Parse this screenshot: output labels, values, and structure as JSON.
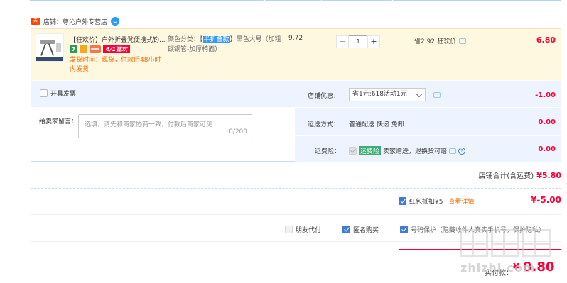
{
  "shop": {
    "icon": "tmall-shop-icon",
    "label": "店铺：尊沁户外专营店"
  },
  "item": {
    "title": "【狂欢价】户外折叠凳便携式钓...",
    "badge_7": "7",
    "badge_618": "6/1狂欢",
    "shipping": "发货时间：现货，付款后48小时内发货",
    "sku_prefix": "颜色分类：【",
    "sku_highlight": "半折叠款",
    "sku_rest": "】黑色大号（加粗碳钢管-加厚椅面）",
    "price": "9.72",
    "quantity": "1",
    "minus": "−",
    "plus": "+",
    "saving": "省2.92:狂欢价",
    "total": "6.80"
  },
  "invoice": {
    "label": "开具发票"
  },
  "message": {
    "label": "给卖家留言：",
    "placeholder": "选填，请先和商家协商一致，付款后商家可见",
    "count": "0/200"
  },
  "discount": {
    "label": "店铺优惠：",
    "selected": "省1元:618活动1元",
    "value": "-1.00"
  },
  "delivery": {
    "label": "运送方式：",
    "value": "普通配送 快递 免邮",
    "amount": "0.00"
  },
  "insurance": {
    "label": "运费险：",
    "tag": "运费险",
    "text": "卖家赠送，退换货可赔",
    "amount": "0.00"
  },
  "shop_total": {
    "label": "店铺合计(含运费)",
    "value": "¥5.80"
  },
  "redpack": {
    "label": "红包抵扣¥5",
    "link": "查看详情",
    "value": "¥-5.00"
  },
  "options": {
    "friend_pay": "朋友代付",
    "anonymous": "匿名购买",
    "privacy": "号码保护（隐藏收件人真实手机号，保护隐私）"
  },
  "pay": {
    "label": "实付款：",
    "currency": "¥",
    "value": "0.80"
  },
  "watermark": {
    "text": "zhizhi.com"
  },
  "colors": {
    "price_red": "#ff0036",
    "orange": "#f56a00",
    "blue_bg": "#edf4ff",
    "item_bg": "#fff8e1",
    "check_blue": "#3d7bd8"
  }
}
